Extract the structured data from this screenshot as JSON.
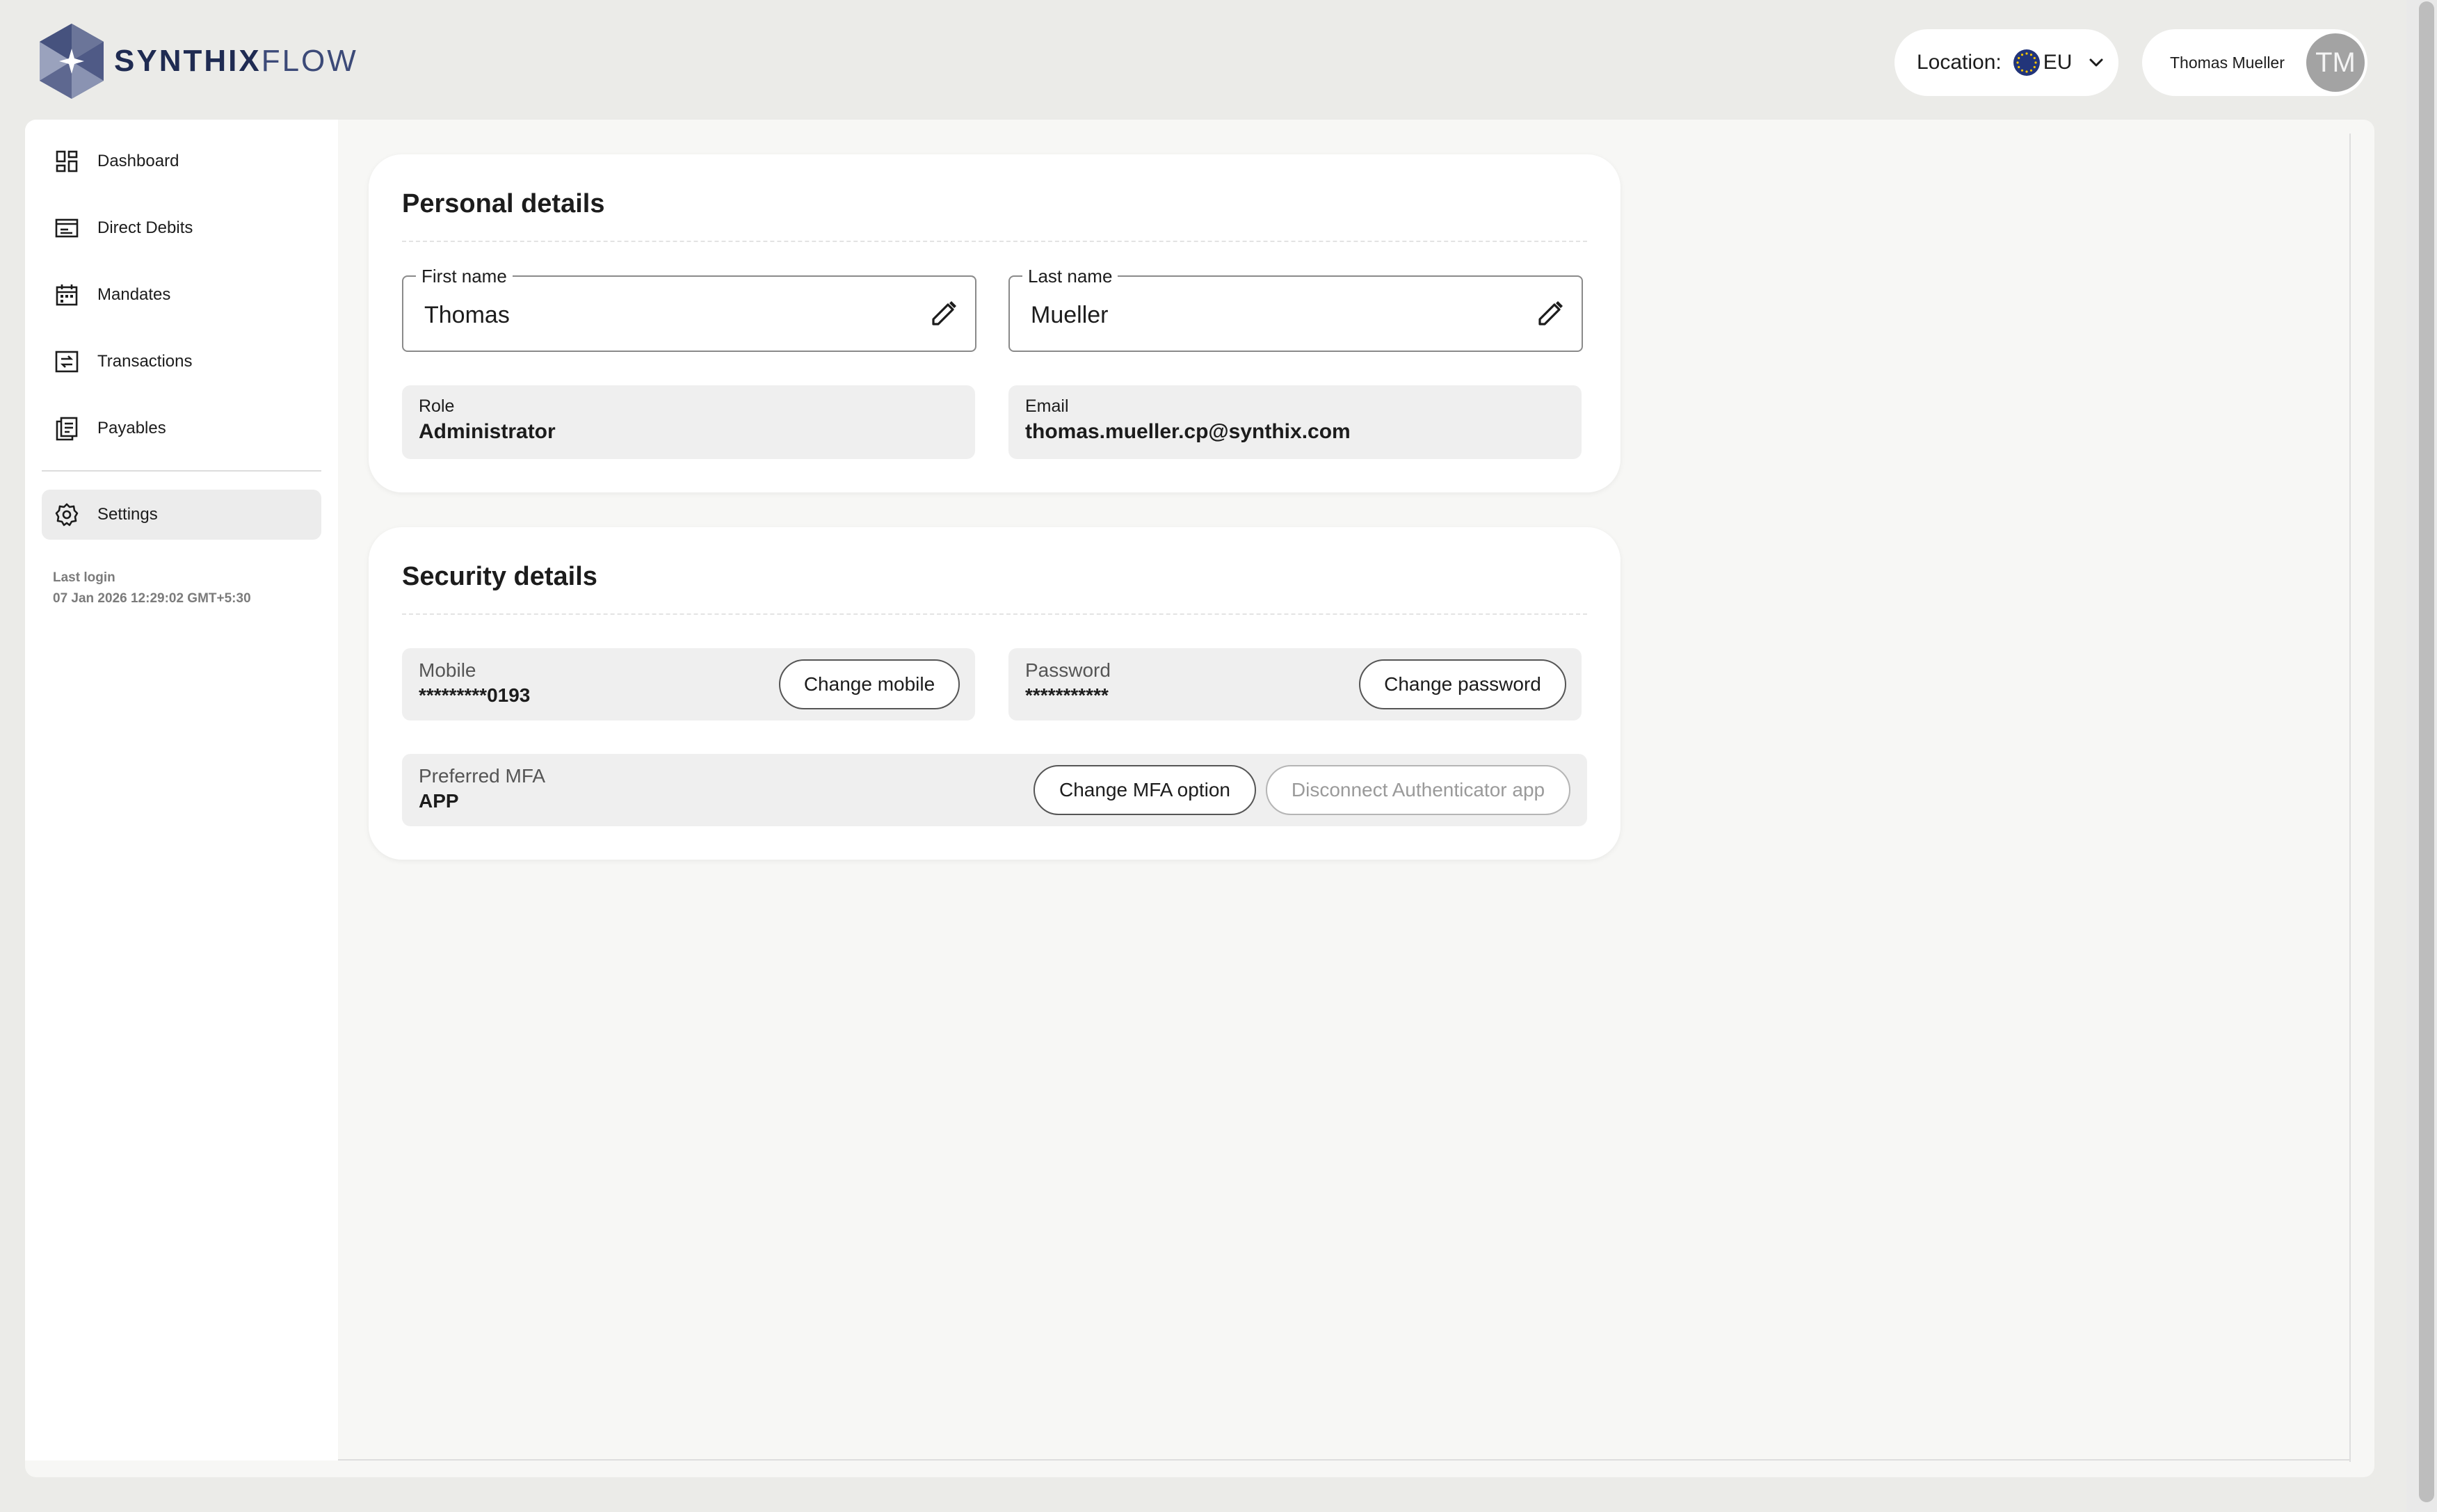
{
  "brand": {
    "name_bold": "SYNTHIX",
    "name_light": "FLOW"
  },
  "header": {
    "location_label": "Location:",
    "location_value": "EU",
    "user_name": "Thomas Mueller",
    "avatar_initials": "TM"
  },
  "sidebar": {
    "items": [
      {
        "label": "Dashboard",
        "icon": "dashboard-icon"
      },
      {
        "label": "Direct Debits",
        "icon": "direct-debits-icon"
      },
      {
        "label": "Mandates",
        "icon": "calendar-icon"
      },
      {
        "label": "Transactions",
        "icon": "transactions-icon"
      },
      {
        "label": "Payables",
        "icon": "payables-icon"
      }
    ],
    "settings": {
      "label": "Settings",
      "icon": "gear-icon",
      "active": true
    },
    "last_login_label": "Last login",
    "last_login_value": "07 Jan 2026 12:29:02 GMT+5:30"
  },
  "personal": {
    "title": "Personal details",
    "first_name_label": "First name",
    "first_name_value": "Thomas",
    "last_name_label": "Last name",
    "last_name_value": "Mueller",
    "role_label": "Role",
    "role_value": "Administrator",
    "email_label": "Email",
    "email_value": "thomas.mueller.cp@synthix.com"
  },
  "security": {
    "title": "Security details",
    "mobile_label": "Mobile",
    "mobile_value": "*********0193",
    "change_mobile": "Change mobile",
    "password_label": "Password",
    "password_value": "***********",
    "change_password": "Change password",
    "mfa_label": "Preferred MFA",
    "mfa_value": "APP",
    "change_mfa": "Change MFA option",
    "disconnect_app": "Disconnect Authenticator app"
  },
  "colors": {
    "brand_navy": "#1f2b52",
    "eu_blue": "#22357a",
    "active_bg": "#ececec"
  }
}
